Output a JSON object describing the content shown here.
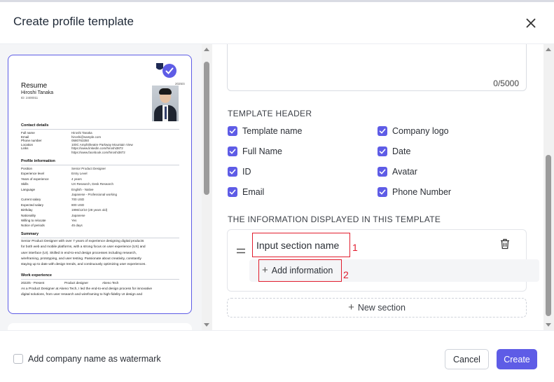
{
  "modal": {
    "title": "Create profile template",
    "close_icon": "close-icon"
  },
  "preview": {
    "title": "Resume",
    "name": "Hiroshi Tanaka",
    "id": "ID: 2400011",
    "date": "2025/4",
    "contact_heading": "Contact details",
    "contact": [
      {
        "k": "Full name",
        "v": "Hiroshi Tanaka"
      },
      {
        "k": "Email",
        "v": "hiroshi@sample.com"
      },
      {
        "k": "Phone number",
        "v": "0580763350"
      },
      {
        "k": "Location",
        "v": "100C Amphitheatre Parkway Mountain View"
      },
      {
        "k": "Links",
        "v": "https://www.linkedin.com/hiroshi3872"
      },
      {
        "k": "",
        "v": "https://www.facebook.com/hiroshi3872"
      }
    ],
    "profile_heading": "Profile information",
    "profile": [
      {
        "k": "Position",
        "v": "Senior Product Designer"
      },
      {
        "k": "Experience level",
        "v": "Entry Level"
      },
      {
        "k": "Years of experience",
        "v": "4 years"
      },
      {
        "k": "Skills",
        "v": "UX Research, Desk Research"
      },
      {
        "k": "Language",
        "v": "English - Native"
      },
      {
        "k": "",
        "v": "Japanese - Professional working"
      },
      {
        "k": "Current salary",
        "v": "700 USD"
      },
      {
        "k": "Expected salary",
        "v": "800 USD"
      },
      {
        "k": "Birthday",
        "v": "1996/12/10 (28 years old)"
      },
      {
        "k": "Nationality",
        "v": "Japanese"
      },
      {
        "k": "Willing to relocate",
        "v": "Yes"
      },
      {
        "k": "Notice of periods",
        "v": "45 days"
      }
    ],
    "summary_heading": "Summary",
    "summary_lines": [
      "Senior Product Designer with over 7 years of experience designing digital products",
      "for both web and mobile platforms, with a strong focus on user experience (UX) and",
      "user interface (UI). Skilled in end-to-end design processes including research,",
      "wireframing, prototyping, and user testing. Passionate about creativity, constantly",
      "staying up to date with design trends, and continuously optimizing user experiences."
    ],
    "work_heading": "Work experience",
    "work_period": "2022/6 - Present",
    "work_role": "Product designer",
    "work_company": "Akeno Tech",
    "work_lines": [
      "As a Product Designer at Akeno Tech, I led the end-to-end design process for innovative",
      "digital solutions, from user research and wireframing to high-fidelity UI design and"
    ]
  },
  "editor": {
    "char_count": "0/5000",
    "header_section_label": "TEMPLATE HEADER",
    "header_options": [
      {
        "label": "Template name",
        "checked": true
      },
      {
        "label": "Company logo",
        "checked": true
      },
      {
        "label": "Full Name",
        "checked": true
      },
      {
        "label": "Date",
        "checked": true
      },
      {
        "label": "ID",
        "checked": true
      },
      {
        "label": "Avatar",
        "checked": true
      },
      {
        "label": "Email",
        "checked": true
      },
      {
        "label": "Phone Number",
        "checked": true
      }
    ],
    "info_section_label": "THE INFORMATION DISPLAYED IN THIS TEMPLATE",
    "section_name_placeholder": "Input section name",
    "annotation_1": "1",
    "add_info_label": "Add information",
    "annotation_2": "2",
    "new_section_label": "New section"
  },
  "footer": {
    "watermark_label": "Add company name as watermark",
    "watermark_checked": false,
    "cancel_label": "Cancel",
    "create_label": "Create"
  },
  "colors": {
    "accent": "#5e5ce6",
    "annotation_red": "#e11d2e"
  }
}
